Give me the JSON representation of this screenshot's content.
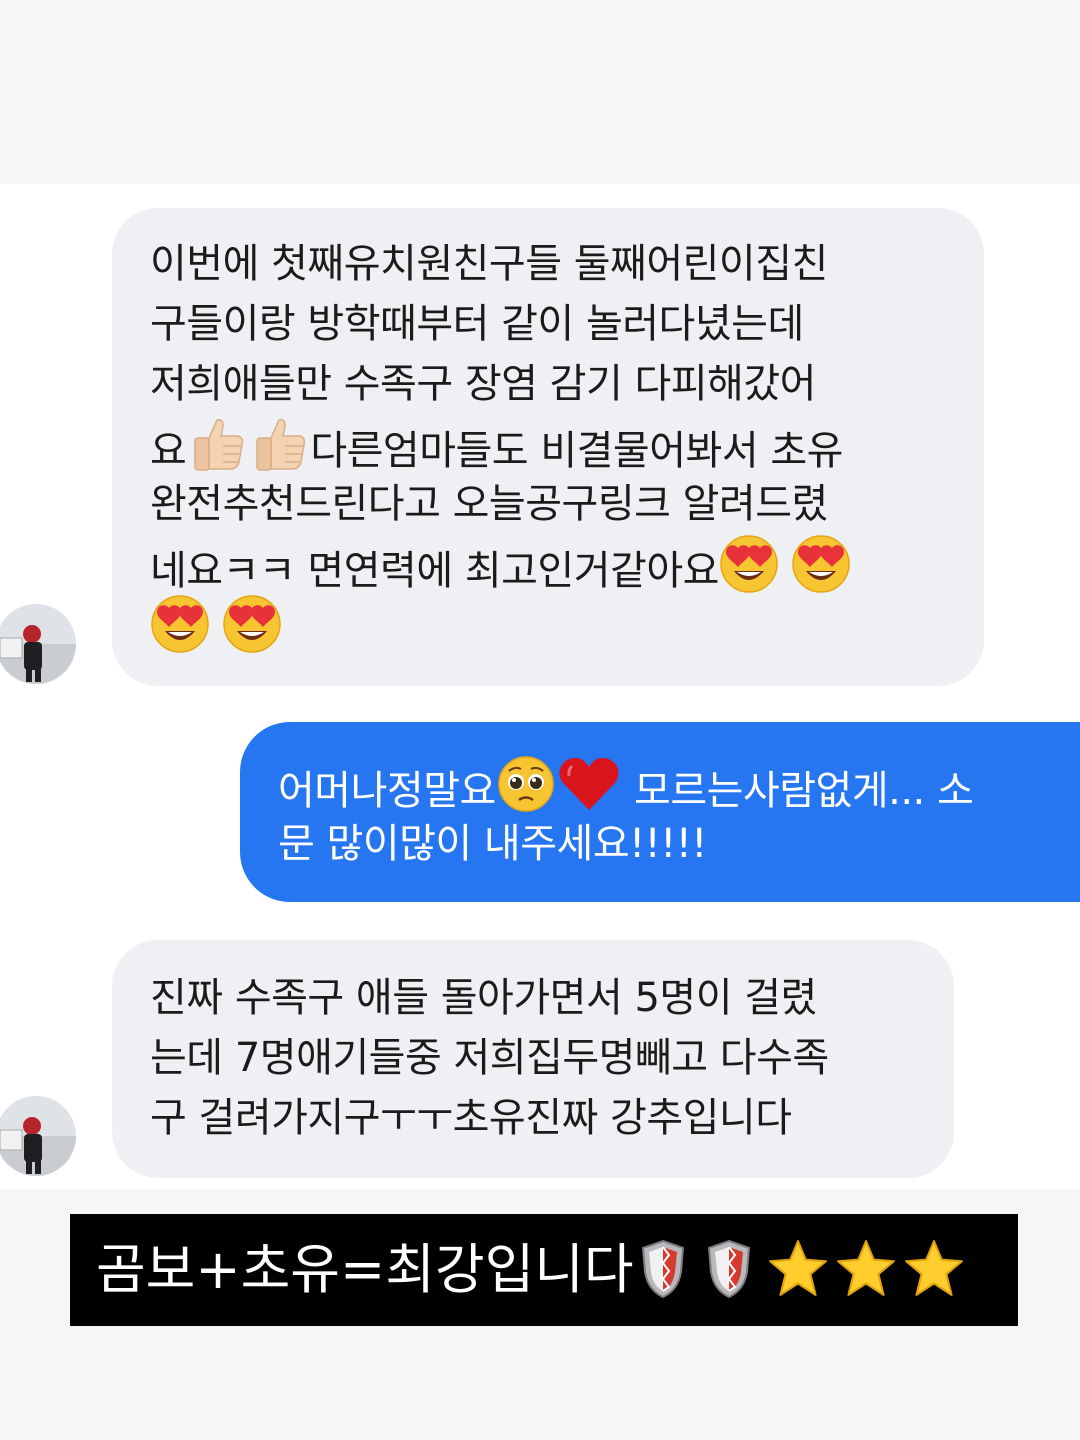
{
  "messages": [
    {
      "direction": "incoming",
      "lines": [
        "이번에 첫째유치원친구들 둘째어린이집친",
        "구들이랑 방학때부터 같이 놀러다녔는데",
        "저희애들만 수족구 장염 감기 다피해갔어",
        "요",
        "다른엄마들도 비결물어봐서 초유",
        "완전추천드린다고 오늘공구링크 알려드렸",
        "네요ㅋㅋ 면연력에 최고인거같아요"
      ],
      "icons": [
        "thumbs-up-icon",
        "heart-eyes-icon"
      ]
    },
    {
      "direction": "outgoing",
      "lines": [
        "어머나정말요",
        "모르는사람없게... 소",
        "문 많이많이 내주세요!!!!!"
      ],
      "icons": [
        "pleading-face-icon",
        "red-heart-icon"
      ]
    },
    {
      "direction": "incoming",
      "lines": [
        "진짜 수족구 애들 돌아가면서 5명이 걸렸",
        "는데 7명애기들중 저희집두명빼고 다수족",
        "구 걸려가지구ㅜㅜ초유진짜 강추입니다"
      ]
    }
  ],
  "caption": {
    "text": "곰보+초유=최강입니다",
    "icons": [
      "shield-icon",
      "star-icon"
    ]
  },
  "colors": {
    "incoming_bubble": "#eff0f3",
    "outgoing_bubble": "#2576f0",
    "caption_background": "#000000",
    "background_band": "#f6f6f8"
  }
}
